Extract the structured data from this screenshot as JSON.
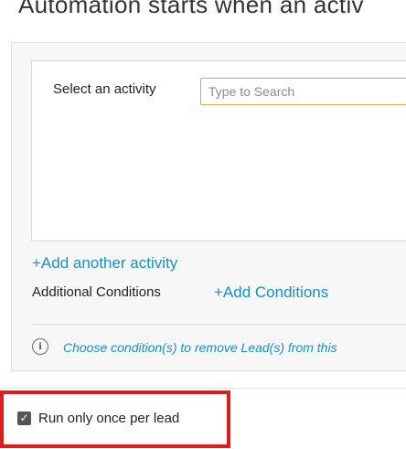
{
  "header": {
    "title": "Automation starts when an activ"
  },
  "activity_panel": {
    "select_label": "Select an activity",
    "search": {
      "placeholder": "Type to Search",
      "value": ""
    },
    "add_activity_link": "+Add another activity"
  },
  "conditions": {
    "label": "Additional Conditions",
    "add_link": "+Add Conditions",
    "info_icon": "info-circle",
    "info_text": "Choose condition(s) to remove Lead(s) from this"
  },
  "options": {
    "run_once": {
      "label": "Run only once per lead",
      "checked": true
    }
  },
  "colors": {
    "link": "#1a8fc4",
    "input_border": "#e8a24a",
    "highlight": "#e01b1b",
    "checkbox": "#555555"
  }
}
